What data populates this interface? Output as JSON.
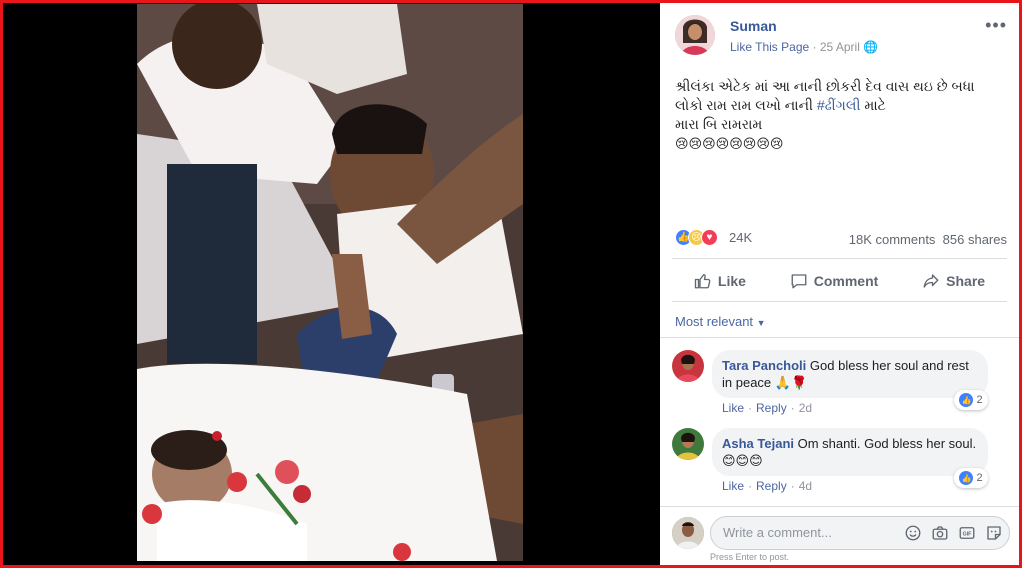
{
  "post": {
    "author": "Suman",
    "like_page": "Like This Page",
    "date": "25 April",
    "text_line1": "શ્રીલંકા એટેક માં આ નાની છોકરી દેવ વાસ થઇ છે બધા",
    "text_line2_pre": "લોકો રામ રામ લખો નાની ",
    "hashtag": "#ઢીંગલી",
    "text_line2_post": " માટે",
    "text_line3": "મારા બિ રામરામ",
    "emoji_line": "😢😢😢😢😢😢😢😢",
    "more_icon": "more-dots-icon"
  },
  "stats": {
    "reaction_count": "24K",
    "comments": "18K comments",
    "shares": "856 shares"
  },
  "actions": {
    "like": "Like",
    "comment": "Comment",
    "share": "Share"
  },
  "sort": {
    "label": "Most relevant"
  },
  "comments": [
    {
      "name": "Tara Pancholi",
      "text": " God bless her soul and rest in peace 🙏🌹",
      "like": "Like",
      "reply": "Reply",
      "age": "2d",
      "reactions": "2"
    },
    {
      "name": "Asha Tejani",
      "text": " Om shanti. God bless her soul. 😊😊😊",
      "like": "Like",
      "reply": "Reply",
      "age": "4d",
      "reactions": "2"
    }
  ],
  "composer": {
    "placeholder": "Write a comment...",
    "hint": "Press Enter to post."
  },
  "colors": {
    "frame": "#e8151b",
    "link": "#385898",
    "like_blue": "#4080ff",
    "love_red": "#f33e58"
  }
}
